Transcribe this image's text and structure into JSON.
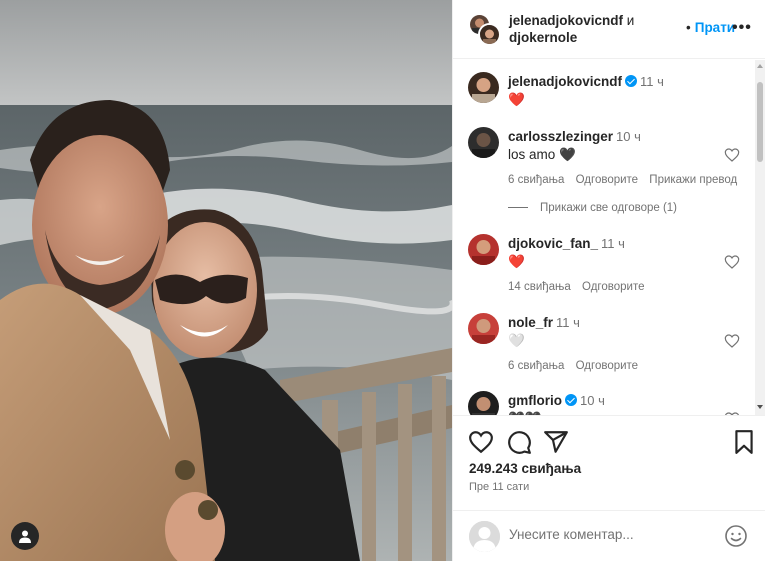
{
  "header": {
    "user1": "jelenadjokovicndf",
    "conjunction": "и",
    "user2": "djokernole",
    "follow_label": "Прати",
    "dot": "•",
    "more_label": "•••"
  },
  "comments": [
    {
      "username": "jelenadjokovicndf",
      "verified": true,
      "time": "11 ч",
      "text": "❤️",
      "likes": "",
      "reply": "",
      "translate": ""
    },
    {
      "username": "carlosszlezinger",
      "verified": false,
      "time": "10 ч",
      "text": "los amo 🖤",
      "likes": "6 свиђања",
      "reply": "Одговорите",
      "translate": "Прикажи превод"
    },
    {
      "username": "djokovic_fan_",
      "verified": false,
      "time": "11 ч",
      "text": "❤️",
      "likes": "14 свиђања",
      "reply": "Одговорите",
      "translate": ""
    },
    {
      "username": "nole_fr",
      "verified": false,
      "time": "11 ч",
      "text": "🤍",
      "likes": "6 свиђања",
      "reply": "Одговорите",
      "translate": ""
    },
    {
      "username": "gmflorio",
      "verified": true,
      "time": "10 ч",
      "text": "🖤🖤",
      "likes": "",
      "reply": "",
      "translate": ""
    }
  ],
  "view_replies": "Прикажи све одговоре (1)",
  "post": {
    "likes": "249.243 свиђања",
    "time_ago": "Пре 11 сати"
  },
  "composer": {
    "placeholder": "Унесите коментар..."
  },
  "icons": {
    "like": "heart-icon",
    "comment": "comment-icon",
    "share": "share-icon",
    "save": "bookmark-icon",
    "emoji": "emoji-icon",
    "tag": "user-tag-icon"
  },
  "colors": {
    "accent": "#0095f6",
    "heart_red": "#ed4956",
    "meta_gray": "#737373"
  }
}
